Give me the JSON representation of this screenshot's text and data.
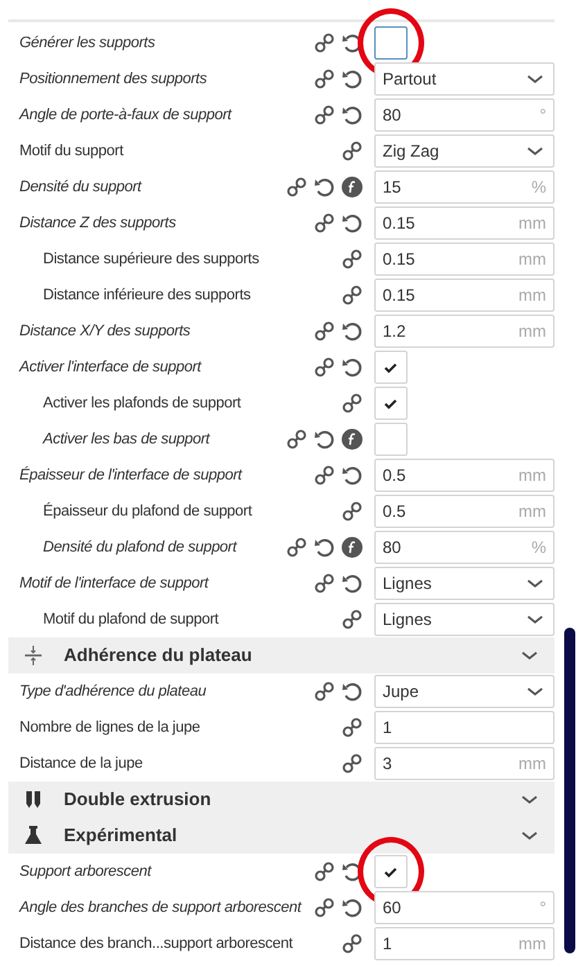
{
  "items": [
    {
      "kind": "setting",
      "label": "Générer les supports",
      "modified": true,
      "formula": false,
      "circled": true,
      "control": {
        "kind": "checkbox",
        "checked": false
      }
    },
    {
      "kind": "setting",
      "label": "Positionnement des supports",
      "modified": true,
      "formula": false,
      "control": {
        "kind": "select",
        "value": "Partout"
      }
    },
    {
      "kind": "setting",
      "label": "Angle de porte-à-faux de support",
      "modified": true,
      "formula": false,
      "control": {
        "kind": "number",
        "value": "80",
        "unit": "°"
      }
    },
    {
      "kind": "setting",
      "label": "Motif du support",
      "modified": false,
      "formula": false,
      "control": {
        "kind": "select",
        "value": "Zig Zag"
      }
    },
    {
      "kind": "setting",
      "label": "Densité du support",
      "modified": true,
      "formula": true,
      "control": {
        "kind": "number",
        "value": "15",
        "unit": "%"
      }
    },
    {
      "kind": "setting",
      "label": "Distance Z des supports",
      "modified": true,
      "formula": false,
      "control": {
        "kind": "number",
        "value": "0.15",
        "unit": "mm"
      },
      "children": [
        {
          "kind": "setting",
          "label": "Distance supérieure des supports",
          "modified": false,
          "formula": false,
          "control": {
            "kind": "number",
            "value": "0.15",
            "unit": "mm"
          }
        },
        {
          "kind": "setting",
          "label": "Distance inférieure des supports",
          "modified": false,
          "formula": false,
          "control": {
            "kind": "number",
            "value": "0.15",
            "unit": "mm"
          }
        }
      ]
    },
    {
      "kind": "setting",
      "label": "Distance X/Y des supports",
      "modified": true,
      "formula": false,
      "control": {
        "kind": "number",
        "value": "1.2",
        "unit": "mm"
      }
    },
    {
      "kind": "setting",
      "label": "Activer l'interface de support",
      "modified": true,
      "formula": false,
      "control": {
        "kind": "checkbox",
        "checked": true
      },
      "children": [
        {
          "kind": "setting",
          "label": "Activer les plafonds de support",
          "modified": false,
          "formula": false,
          "control": {
            "kind": "checkbox",
            "checked": true
          }
        },
        {
          "kind": "setting",
          "label": "Activer les bas de support",
          "modified": true,
          "formula": true,
          "control": {
            "kind": "checkbox",
            "checked": false
          }
        }
      ]
    },
    {
      "kind": "setting",
      "label": "Épaisseur de l'interface de support",
      "modified": true,
      "formula": false,
      "control": {
        "kind": "number",
        "value": "0.5",
        "unit": "mm"
      },
      "children": [
        {
          "kind": "setting",
          "label": "Épaisseur du plafond de support",
          "modified": false,
          "formula": false,
          "control": {
            "kind": "number",
            "value": "0.5",
            "unit": "mm"
          }
        },
        {
          "kind": "setting",
          "label": "Densité du plafond de support",
          "modified": true,
          "formula": true,
          "control": {
            "kind": "number",
            "value": "80",
            "unit": "%"
          }
        }
      ]
    },
    {
      "kind": "setting",
      "label": "Motif de l'interface de support",
      "modified": true,
      "formula": false,
      "control": {
        "kind": "select",
        "value": "Lignes"
      },
      "children": [
        {
          "kind": "setting",
          "label": "Motif du plafond de support",
          "modified": false,
          "formula": false,
          "control": {
            "kind": "select",
            "value": "Lignes"
          }
        }
      ]
    },
    {
      "kind": "section",
      "title": "Adhérence du plateau"
    },
    {
      "kind": "setting",
      "label": "Type d'adhérence du plateau",
      "modified": true,
      "formula": false,
      "control": {
        "kind": "select",
        "value": "Jupe"
      }
    },
    {
      "kind": "setting",
      "label": "Nombre de lignes de la jupe",
      "modified": false,
      "formula": false,
      "control": {
        "kind": "number",
        "value": "1"
      }
    },
    {
      "kind": "setting",
      "label": "Distance de la jupe",
      "modified": false,
      "formula": false,
      "control": {
        "kind": "number",
        "value": "3",
        "unit": "mm"
      }
    },
    {
      "kind": "section",
      "title": "Double extrusion"
    },
    {
      "kind": "section",
      "title": "Expérimental"
    },
    {
      "kind": "setting",
      "label": "Support arborescent",
      "modified": true,
      "formula": false,
      "circled": true,
      "control": {
        "kind": "checkbox",
        "checked": true
      }
    },
    {
      "kind": "setting",
      "label": "Angle des branches de support arborescent",
      "modified": true,
      "formula": false,
      "control": {
        "kind": "number",
        "value": "60",
        "unit": "°"
      }
    },
    {
      "kind": "setting",
      "label": "Distance des branch...support arborescent",
      "modified": false,
      "formula": false,
      "control": {
        "kind": "number",
        "value": "1",
        "unit": "mm"
      }
    }
  ]
}
